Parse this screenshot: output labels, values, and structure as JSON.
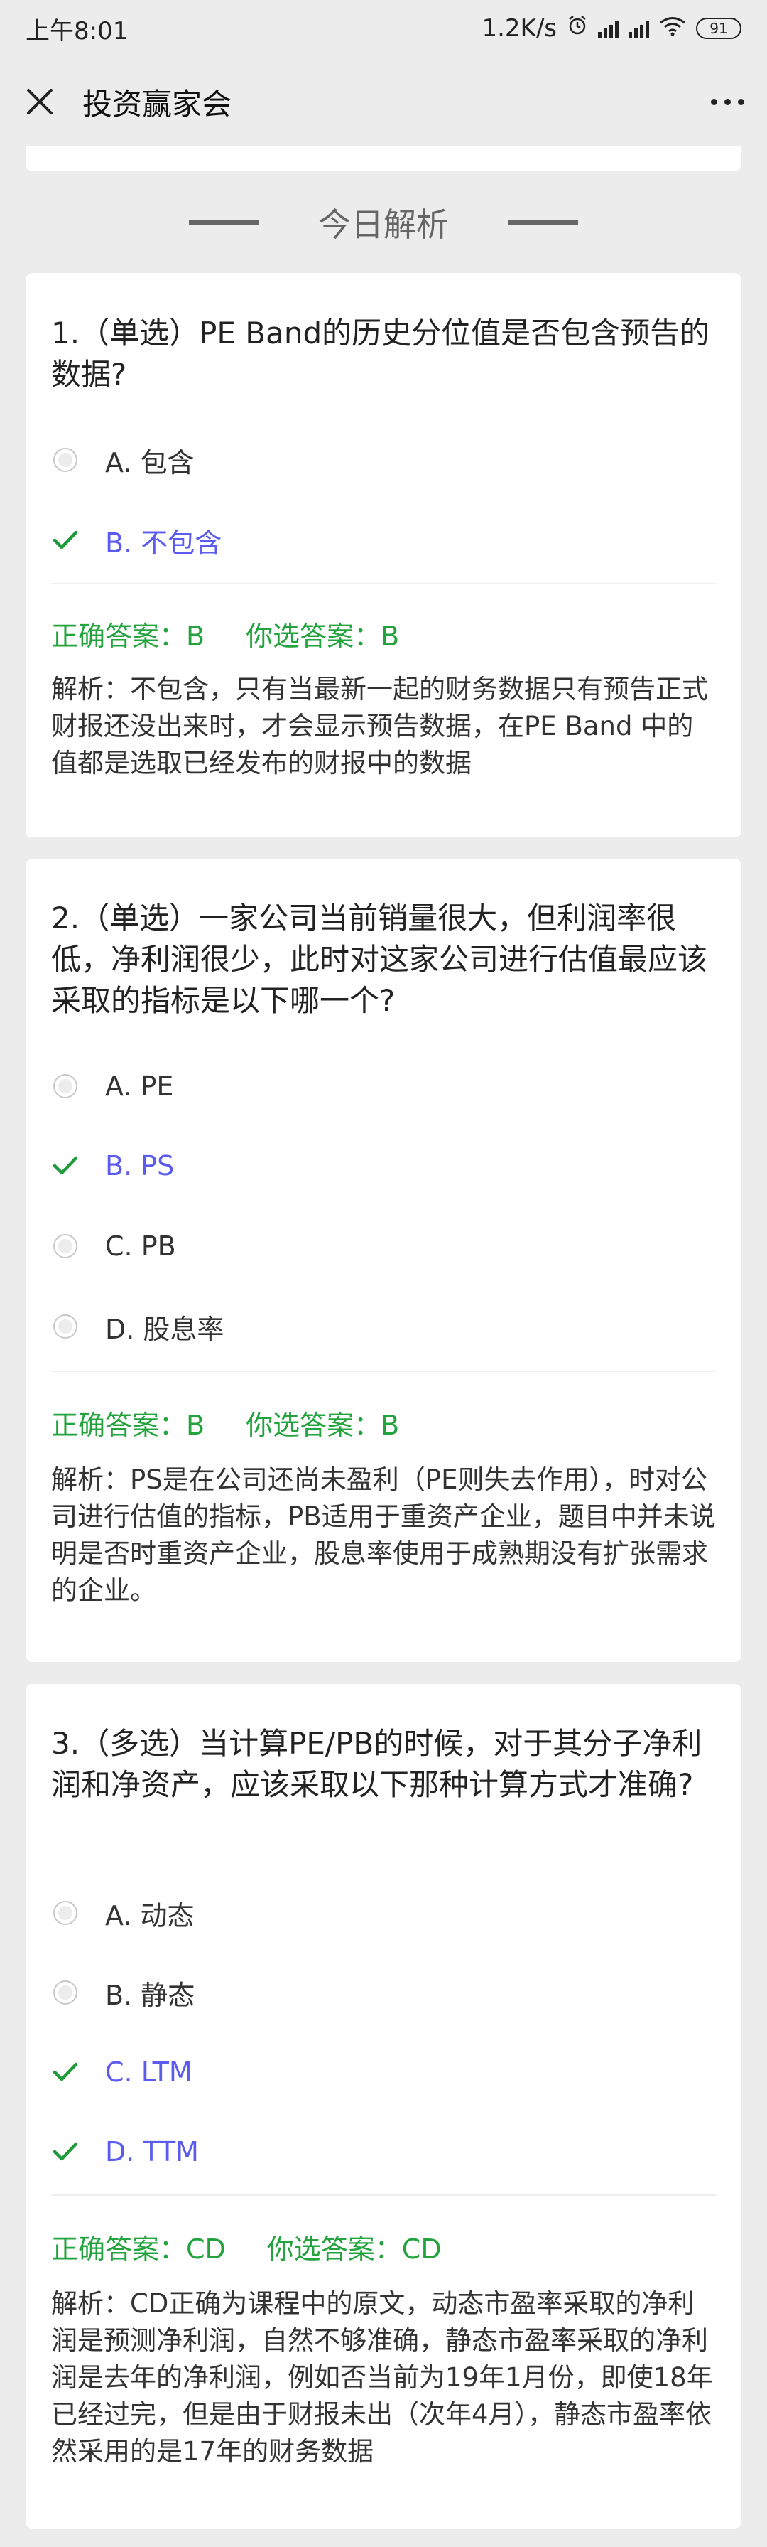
{
  "status": {
    "time": "上午8:01",
    "speed": "1.2K/s",
    "battery": "91"
  },
  "nav": {
    "title": "投资赢家会"
  },
  "section": {
    "title": "今日解析"
  },
  "questions": [
    {
      "text": "1.（单选）PE Band的历史分位值是否包含预告的数据?",
      "options": [
        "A. 包含",
        "B. 不包含"
      ],
      "correct": "正确答案：B",
      "chosen": "你选答案：B",
      "explanation": "解析：不包含，只有当最新一起的财务数据只有预告正式财报还没出来时，才会显示预告数据，在PE Band 中的值都是选取已经发布的财报中的数据"
    },
    {
      "text": "2.（单选）一家公司当前销量很大，但利润率很低，净利润很少，此时对这家公司进行估值最应该采取的指标是以下哪一个?",
      "options": [
        "A. PE",
        "B. PS",
        "C. PB",
        "D. 股息率"
      ],
      "correct": "正确答案：B",
      "chosen": "你选答案：B",
      "explanation": "解析：PS是在公司还尚未盈利（PE则失去作用），时对公司进行估值的指标，PB适用于重资产企业，题目中并未说明是否时重资产企业，股息率使用于成熟期没有扩张需求的企业。"
    },
    {
      "text": "3.（多选）当计算PE/PB的时候，对于其分子净利润和净资产，应该采取以下那种计算方式才准确?",
      "options": [
        "A. 动态",
        "B. 静态",
        "C. LTM",
        "D. TTM"
      ],
      "correct": "正确答案：CD",
      "chosen": "你选答案：CD",
      "explanation": "解析：CD正确为课程中的原文，动态市盈率采取的净利润是预测净利润，自然不够准确，静态市盈率采取的净利润是去年的净利润，例如否当前为19年1月份，即使18年已经过完，但是由于财报未出（次年4月），静态市盈率依然采用的是17年的财务数据"
    }
  ],
  "colors": {
    "selected": "#5b5bf0",
    "answer": "#23a33d",
    "check": "#1f9a3a"
  }
}
